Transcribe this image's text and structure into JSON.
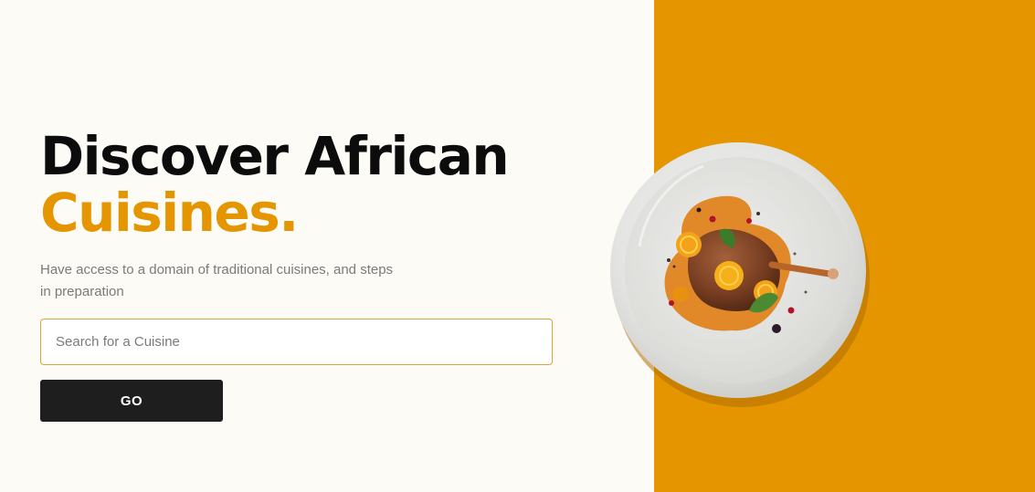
{
  "hero": {
    "title_line1": "Discover African",
    "title_line2": "Cuisines.",
    "subtitle": "Have access to a domain of traditional cuisines, and steps in preparation"
  },
  "search": {
    "placeholder": "Search for a Cuisine",
    "value": ""
  },
  "actions": {
    "go_label": "GO"
  },
  "colors": {
    "accent": "#e59500",
    "background": "#fdfbf6",
    "button": "#1e1e1e",
    "title": "#0c0c0c",
    "subtitle": "#7a7a7a"
  },
  "images": {
    "plate": "plated-duck-dish-image"
  }
}
